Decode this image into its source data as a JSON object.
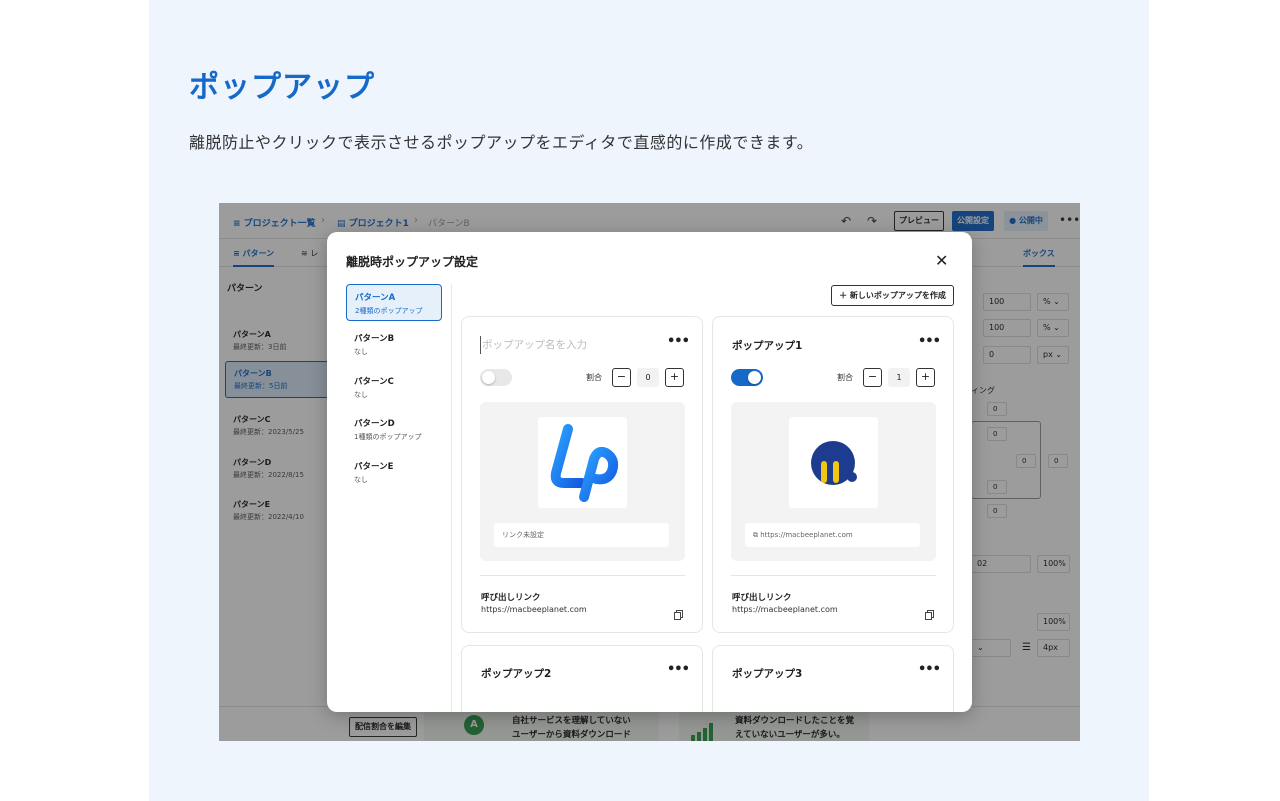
{
  "section": {
    "title": "ポップアップ",
    "description": "離脱防止やクリックで表示させるポップアップをエディタで直感的に作成できます。"
  },
  "editor": {
    "breadcrumbs": [
      "≡ プロジェクト一覧",
      "プロジェクト1",
      "パターンB"
    ],
    "toolbar": {
      "undo_icon": "↶",
      "redo_icon": "↷",
      "preview_label": "プレビュー",
      "publish_settings_label": "公開設定",
      "live_label": "● 公開中",
      "more_icon": "•••"
    },
    "tabs": {
      "pattern": "≡ パターン",
      "layer": "≋ レ",
      "box": "ボックス"
    },
    "sidebar": {
      "heading": "パターン",
      "items": [
        {
          "name": "パターンA",
          "date": "最終更新：3日前"
        },
        {
          "name": "パターンB",
          "date": "最終更新：5日前"
        },
        {
          "name": "パターンC",
          "date": "最終更新：2023/5/25"
        },
        {
          "name": "パターンD",
          "date": "最終更新：2022/8/15"
        },
        {
          "name": "パターンE",
          "date": "最終更新：2022/4/10"
        }
      ]
    },
    "right_panel": {
      "w_value": "100",
      "w_unit": "% ⌄",
      "h_value": "100",
      "h_unit": "% ⌄",
      "r_value": "0",
      "r_unit": "px ⌄",
      "padding_label": "ィング",
      "pad_values": [
        "0",
        "0",
        "0",
        "0",
        "0",
        "0"
      ],
      "color_value": "02",
      "color_pct": "100%",
      "opacity_pct": "100%",
      "border_width": "4px"
    },
    "bottom": {
      "edit_ratio_label": "配信割合を編集",
      "banner_text_1": "自社サービスを理解していない",
      "banner_text_1b": "ユーザーから資料ダウンロード",
      "banner_text_2": "資料ダウンロードしたことを覚",
      "banner_text_2b": "えていないユーザーが多い。"
    }
  },
  "modal": {
    "title": "離脱時ポップアップ設定",
    "close_icon": "✕",
    "new_button": "＋ 新しいポップアップを作成",
    "patterns": [
      {
        "name": "パターンA",
        "desc": "2種類のポップアップ"
      },
      {
        "name": "パターンB",
        "desc": "なし"
      },
      {
        "name": "パターンC",
        "desc": "なし"
      },
      {
        "name": "パターンD",
        "desc": "1種類のポップアップ"
      },
      {
        "name": "パターンE",
        "desc": "なし"
      }
    ],
    "cards": [
      {
        "name_placeholder": "ポップアップ名を入力",
        "dots": "•••",
        "toggle_on": false,
        "ratio_label": "割合",
        "minus": "−",
        "plus": "+",
        "ratio_value": "0",
        "link_field": "リンク未設定",
        "call_title": "呼び出しリンク",
        "call_url": "https://macbeeplanet.com",
        "logo_icon": "lp-logo-icon"
      },
      {
        "name": "ポップアップ1",
        "dots": "•••",
        "toggle_on": true,
        "ratio_label": "割合",
        "minus": "−",
        "plus": "+",
        "ratio_value": "1",
        "link_field": "https://macbeeplanet.com",
        "call_title": "呼び出しリンク",
        "call_url": "https://macbeeplanet.com",
        "logo_icon": "macbee-logo-icon"
      },
      {
        "name": "ポップアップ2",
        "dots": "•••"
      },
      {
        "name": "ポップアップ3",
        "dots": "•••"
      }
    ]
  },
  "colors": {
    "accent": "#1769c9",
    "page_bg": "#eef5fd"
  }
}
